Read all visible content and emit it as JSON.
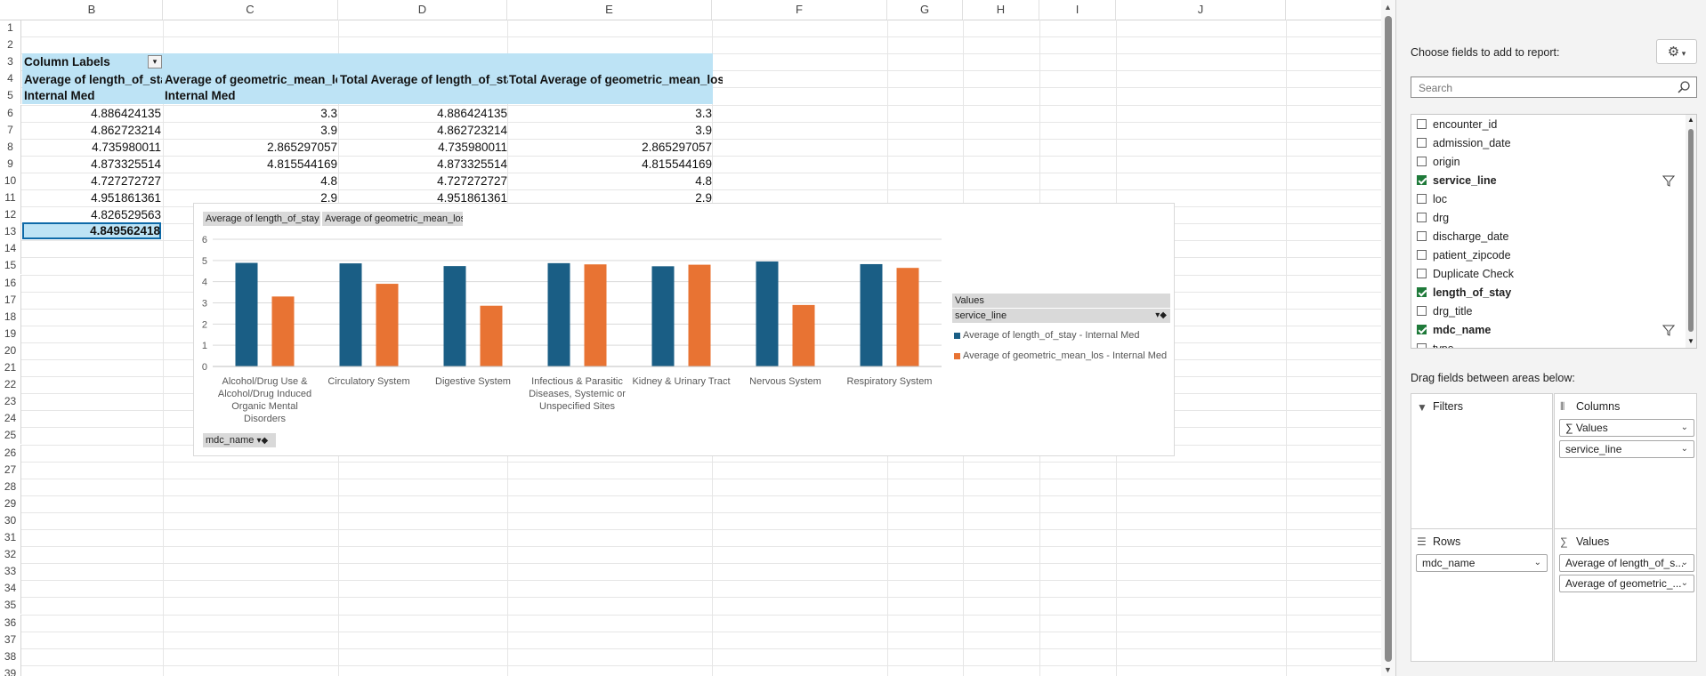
{
  "sheet": {
    "columns": [
      "B",
      "C",
      "D",
      "E",
      "F",
      "G",
      "H",
      "I",
      "J"
    ],
    "rows": [
      "1",
      "2",
      "3",
      "4",
      "5",
      "6",
      "7",
      "8",
      "9",
      "10",
      "11",
      "12",
      "13",
      "14",
      "15",
      "16",
      "17",
      "18",
      "19",
      "20",
      "21",
      "22",
      "23",
      "24",
      "25",
      "26",
      "27",
      "28",
      "29",
      "30",
      "31",
      "32",
      "33",
      "34",
      "35",
      "36",
      "37",
      "38",
      "39"
    ]
  },
  "pivot": {
    "column_labels": "Column Labels",
    "headers": [
      "Average of length_of_sta",
      "Average of geometric_mean_lo",
      "Total Average of length_of_sta",
      "Total Average of geometric_mean_los"
    ],
    "service_headers": [
      "Internal Med",
      "Internal Med"
    ],
    "rows": [
      [
        "4.886424135",
        "3.3",
        "4.886424135",
        "3.3"
      ],
      [
        "4.862723214",
        "3.9",
        "4.862723214",
        "3.9"
      ],
      [
        "4.735980011",
        "2.865297057",
        "4.735980011",
        "2.865297057"
      ],
      [
        "4.873325514",
        "4.815544169",
        "4.873325514",
        "4.815544169"
      ],
      [
        "4.727272727",
        "4.8",
        "4.727272727",
        "4.8"
      ],
      [
        "4.951861361",
        "2.9",
        "4.951861361",
        "2.9"
      ],
      [
        "4.826529563",
        "",
        "",
        ""
      ]
    ],
    "total": "4.849562418"
  },
  "chart_data": {
    "type": "bar",
    "categories": [
      "Alcohol/Drug Use & Alcohol/Drug Induced Organic Mental Disorders",
      "Circulatory System",
      "Digestive System",
      "Infectious & Parasitic Diseases, Systemic or Unspecified Sites",
      "Kidney & Urinary Tract",
      "Nervous System",
      "Respiratory System"
    ],
    "category_lines": [
      [
        "Alcohol/Drug Use &",
        "Alcohol/Drug Induced",
        "Organic Mental",
        "Disorders"
      ],
      [
        "Circulatory System"
      ],
      [
        "Digestive System"
      ],
      [
        "Infectious & Parasitic",
        "Diseases, Systemic or",
        "Unspecified Sites"
      ],
      [
        "Kidney & Urinary Tract"
      ],
      [
        "Nervous System"
      ],
      [
        "Respiratory System"
      ]
    ],
    "series": [
      {
        "name": "Average of length_of_stay - Internal Med",
        "color": "#1a5e85",
        "values": [
          4.886,
          4.863,
          4.736,
          4.873,
          4.727,
          4.952,
          4.827
        ]
      },
      {
        "name": "Average of geometric_mean_los - Internal Med",
        "color": "#e87333",
        "values": [
          3.3,
          3.9,
          2.865,
          4.816,
          4.8,
          2.9,
          4.65
        ]
      }
    ],
    "ylim": [
      0,
      6
    ],
    "yticks": [
      "0",
      "1",
      "2",
      "3",
      "4",
      "5",
      "6"
    ],
    "grid": true,
    "legend_placement": "right",
    "field_buttons": [
      "Average of length_of_stay",
      "Average of geometric_mean_los"
    ],
    "axis_field": "mdc_name",
    "legend_title": "Values",
    "legend_field": "service_line"
  },
  "pane": {
    "choose_label": "Choose fields to add to report:",
    "search_placeholder": "Search",
    "fields": [
      {
        "name": "encounter_id",
        "checked": false,
        "bold": false,
        "filter": false
      },
      {
        "name": "admission_date",
        "checked": false,
        "bold": false,
        "filter": false
      },
      {
        "name": "origin",
        "checked": false,
        "bold": false,
        "filter": false
      },
      {
        "name": "service_line",
        "checked": true,
        "bold": true,
        "filter": true
      },
      {
        "name": "loc",
        "checked": false,
        "bold": false,
        "filter": false
      },
      {
        "name": "drg",
        "checked": false,
        "bold": false,
        "filter": false
      },
      {
        "name": "discharge_date",
        "checked": false,
        "bold": false,
        "filter": false
      },
      {
        "name": "patient_zipcode",
        "checked": false,
        "bold": false,
        "filter": false
      },
      {
        "name": "Duplicate Check",
        "checked": false,
        "bold": false,
        "filter": false
      },
      {
        "name": "length_of_stay",
        "checked": true,
        "bold": true,
        "filter": false
      },
      {
        "name": "drg_title",
        "checked": false,
        "bold": false,
        "filter": false
      },
      {
        "name": "mdc_name",
        "checked": true,
        "bold": true,
        "filter": true
      },
      {
        "name": "type",
        "checked": false,
        "bold": false,
        "filter": false
      }
    ],
    "drag_label": "Drag fields between areas below:",
    "areas": {
      "filters": "Filters",
      "columns": "Columns",
      "rows": "Rows",
      "values": "Values",
      "columns_items": [
        "Values",
        "service_line"
      ],
      "rows_items": [
        "mdc_name"
      ],
      "values_items": [
        "Average of length_of_s...",
        "Average of geometric_..."
      ]
    }
  }
}
